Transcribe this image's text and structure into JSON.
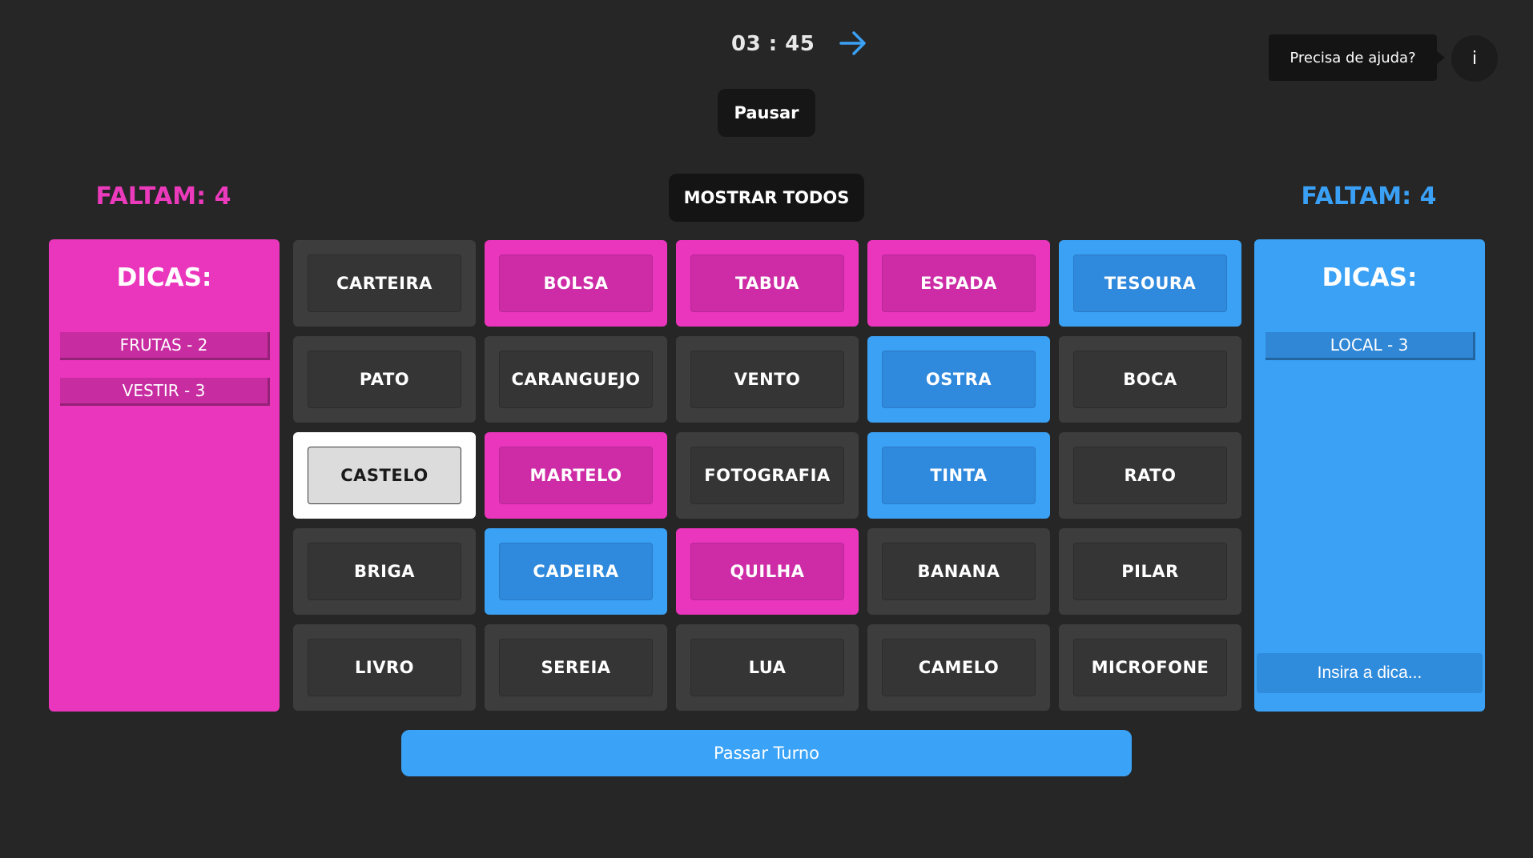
{
  "timer": {
    "text": "03 : 45"
  },
  "controls": {
    "pause_label": "Pausar",
    "show_all_label": "MOSTRAR TODOS",
    "pass_turn_label": "Passar Turno",
    "next_icon": "arrow-right-icon"
  },
  "help": {
    "tooltip": "Precisa de ajuda?",
    "info_label": "i"
  },
  "teams": {
    "pink": {
      "color": "#ea36bd",
      "remaining": "FALTAM: 4",
      "hints_title": "DICAS:",
      "hints": [
        "FRUTAS - 2",
        "VESTIR - 3"
      ]
    },
    "blue": {
      "color": "#3aa1f5",
      "remaining": "FALTAM: 4",
      "hints_title": "DICAS:",
      "hints": [
        "LOCAL - 3"
      ],
      "hint_placeholder": "Insira a dica..."
    }
  },
  "board": {
    "cards": [
      {
        "word": "CARTEIRA",
        "state": "hidden"
      },
      {
        "word": "BOLSA",
        "state": "pink"
      },
      {
        "word": "TABUA",
        "state": "pink"
      },
      {
        "word": "ESPADA",
        "state": "pink"
      },
      {
        "word": "TESOURA",
        "state": "blue"
      },
      {
        "word": "PATO",
        "state": "hidden"
      },
      {
        "word": "CARANGUEJO",
        "state": "hidden"
      },
      {
        "word": "VENTO",
        "state": "hidden"
      },
      {
        "word": "OSTRA",
        "state": "blue"
      },
      {
        "word": "BOCA",
        "state": "hidden"
      },
      {
        "word": "CASTELO",
        "state": "white"
      },
      {
        "word": "MARTELO",
        "state": "pink"
      },
      {
        "word": "FOTOGRAFIA",
        "state": "hidden"
      },
      {
        "word": "TINTA",
        "state": "blue"
      },
      {
        "word": "RATO",
        "state": "hidden"
      },
      {
        "word": "BRIGA",
        "state": "hidden"
      },
      {
        "word": "CADEIRA",
        "state": "blue"
      },
      {
        "word": "QUILHA",
        "state": "pink"
      },
      {
        "word": "BANANA",
        "state": "hidden"
      },
      {
        "word": "PILAR",
        "state": "hidden"
      },
      {
        "word": "LIVRO",
        "state": "hidden"
      },
      {
        "word": "SEREIA",
        "state": "hidden"
      },
      {
        "word": "LUA",
        "state": "hidden"
      },
      {
        "word": "CAMELO",
        "state": "hidden"
      },
      {
        "word": "MICROFONE",
        "state": "hidden"
      }
    ]
  }
}
